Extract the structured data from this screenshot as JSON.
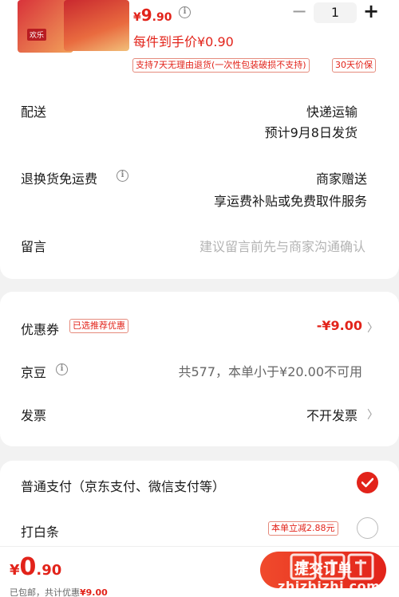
{
  "product": {
    "price_currency": "¥",
    "price_int": "9",
    "price_dec": ".90",
    "quantity": "1",
    "each_price": "每件到手价¥0.90",
    "badge_return": "支持7天无理由退货(一次性包装破损不支持)",
    "badge_price": "30天价保",
    "thumb_tag": "欢乐"
  },
  "delivery": {
    "label": "配送",
    "method": "快递运输",
    "estimate": "预计9月8日发货"
  },
  "return_shipping": {
    "label": "退换货免运费",
    "value": "商家赠送",
    "detail": "享运费补贴或免费取件服务"
  },
  "message": {
    "label": "留言",
    "placeholder": "建议留言前先与商家沟通确认"
  },
  "coupon": {
    "label": "优惠券",
    "tag": "已选推荐优惠",
    "value": "-¥9.00"
  },
  "jingdou": {
    "label": "京豆",
    "value": "共577，本单小于¥20.00不可用"
  },
  "invoice": {
    "label": "发票",
    "value": "不开发票"
  },
  "payment": {
    "normal_label": "普通支付（京东支付、微信支付等）",
    "baitiao_label": "打白条",
    "baitiao_tag": "本单立减2.88元"
  },
  "bottom": {
    "total_currency": "¥",
    "total_int": "0",
    "total_dec": ".90",
    "shipping_note": "已包邮，共计优惠",
    "discount": "¥9.00",
    "submit_label": "提交订单",
    "watermark": "zhizhizhi.com"
  },
  "colors": {
    "accent": "#e2231a",
    "background": "#f2f2f2"
  },
  "icons": [
    "info-icon",
    "chevron-right-icon",
    "check-icon",
    "minus-icon",
    "plus-icon"
  ]
}
